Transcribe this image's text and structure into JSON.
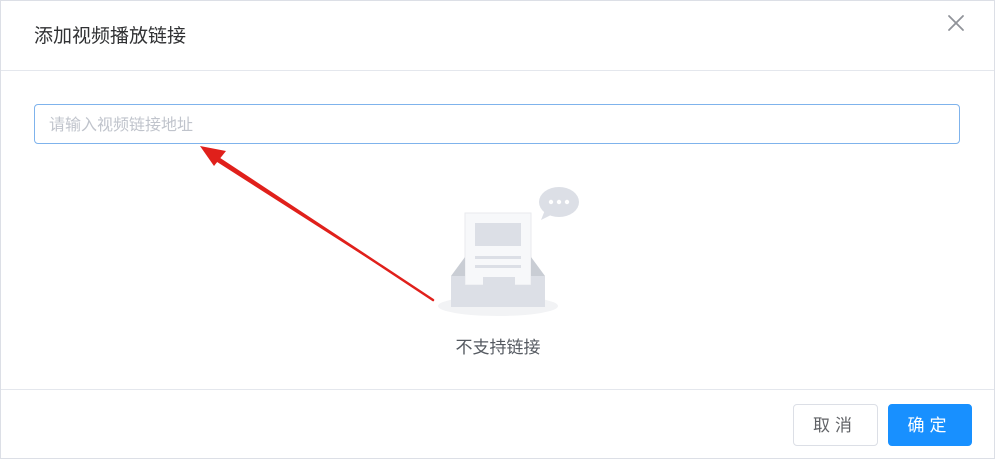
{
  "dialog": {
    "title": "添加视频播放链接",
    "close_icon": "close-icon"
  },
  "input": {
    "placeholder": "请输入视频链接地址",
    "value": ""
  },
  "empty": {
    "icon": "empty-inbox-icon",
    "text": "不支持链接"
  },
  "footer": {
    "cancel_label": "取消",
    "confirm_label": "确定"
  },
  "colors": {
    "accent": "#1890ff",
    "annotation_arrow": "#e0201b"
  }
}
